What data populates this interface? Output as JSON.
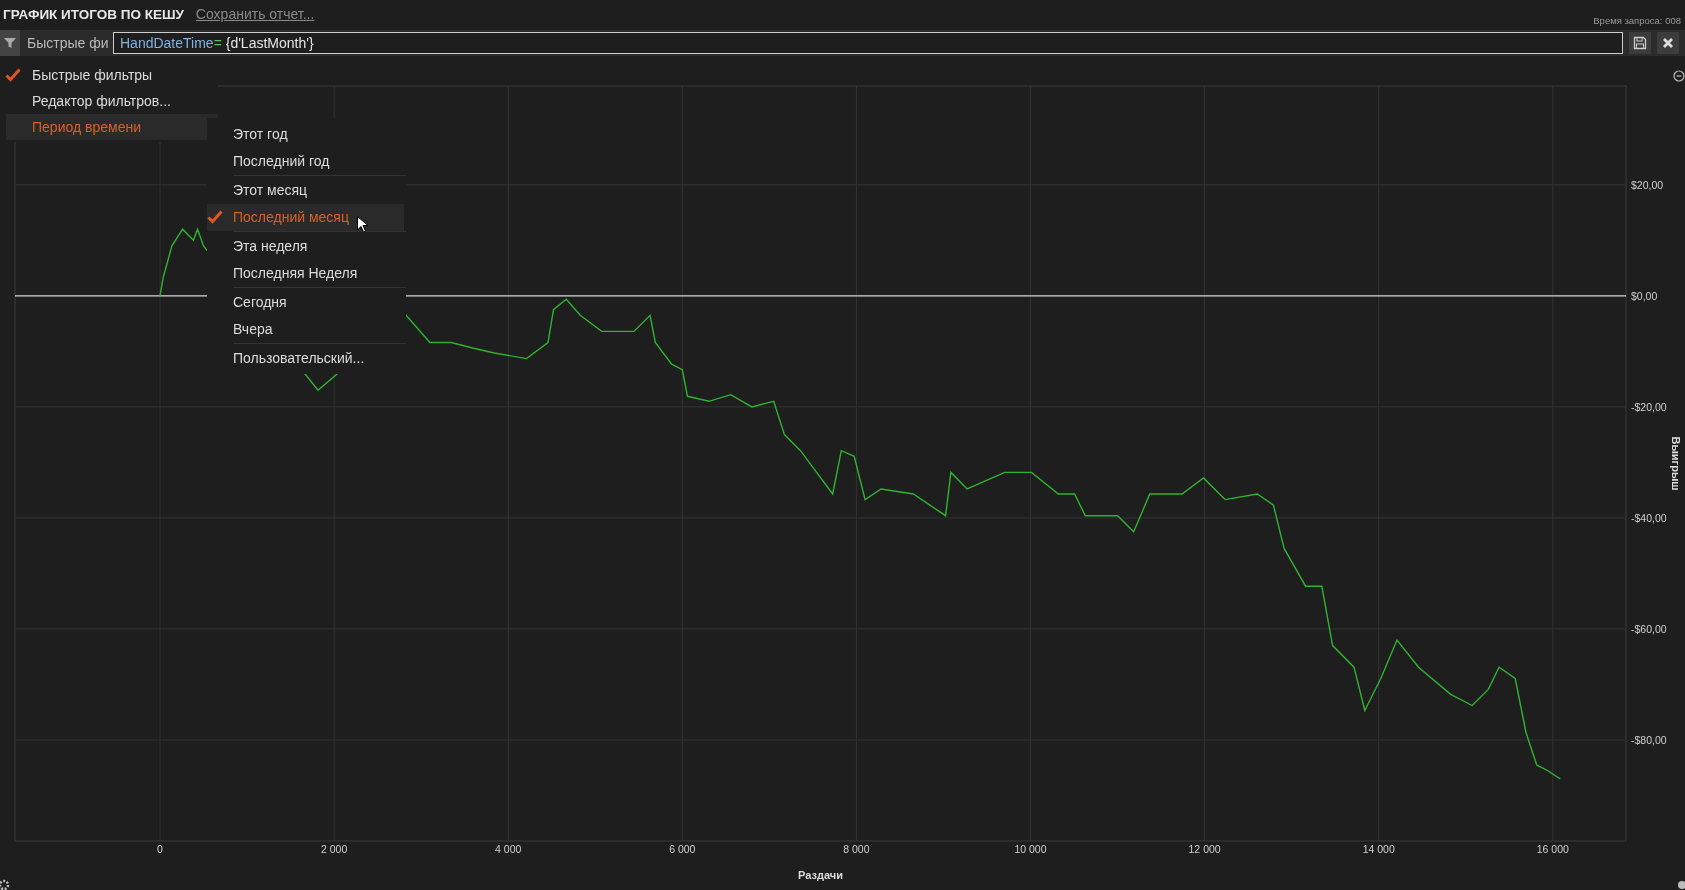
{
  "header": {
    "title": "ГРАФИК ИТОГОВ ПО КЕШУ",
    "save_link": "Сохранить отчет...",
    "query_time": "Время запроса: 008"
  },
  "filter_bar": {
    "label": "Быстрые фи",
    "expression": [
      {
        "kind": "field",
        "text": "HandDateTime"
      },
      {
        "kind": "operator",
        "text": "="
      },
      {
        "kind": "value",
        "text": " {d'LastMonth'}"
      }
    ]
  },
  "menu": {
    "items": [
      {
        "label": "Быстрые фильтры",
        "checked": true,
        "selected": false,
        "submenu": false
      },
      {
        "label": "Редактор фильтров...",
        "checked": false,
        "selected": false,
        "submenu": false
      },
      {
        "label": "Период времени",
        "checked": false,
        "selected": true,
        "submenu": true
      }
    ]
  },
  "submenu": {
    "items": [
      {
        "label": "Этот год",
        "checked": false,
        "selected": false,
        "separator_after": false
      },
      {
        "label": "Последний год",
        "checked": false,
        "selected": false,
        "separator_after": true
      },
      {
        "label": "Этот месяц",
        "checked": false,
        "selected": false,
        "separator_after": false
      },
      {
        "label": "Последний месяц",
        "checked": true,
        "selected": true,
        "separator_after": true
      },
      {
        "label": "Эта неделя",
        "checked": false,
        "selected": false,
        "separator_after": false
      },
      {
        "label": "Последняя Неделя",
        "checked": false,
        "selected": false,
        "separator_after": true
      },
      {
        "label": "Сегодня",
        "checked": false,
        "selected": false,
        "separator_after": false
      },
      {
        "label": "Вчера",
        "checked": false,
        "selected": false,
        "separator_after": true
      },
      {
        "label": "Пользовательский...",
        "checked": false,
        "selected": false,
        "separator_after": false
      }
    ]
  },
  "chart": {
    "chart_data": {
      "type": "line",
      "grid": true,
      "xlabel": "Раздачи",
      "ylabel": "Выигрыш",
      "xlim": [
        -1666,
        16841
      ],
      "ylim": [
        -98.2,
        37.8
      ],
      "xticks": [
        {
          "value": 0,
          "label": "0"
        },
        {
          "value": 2000,
          "label": "2 000"
        },
        {
          "value": 4000,
          "label": "4 000"
        },
        {
          "value": 6000,
          "label": "6 000"
        },
        {
          "value": 8000,
          "label": "8 000"
        },
        {
          "value": 10000,
          "label": "10 000"
        },
        {
          "value": 12000,
          "label": "12 000"
        },
        {
          "value": 14000,
          "label": "14 000"
        },
        {
          "value": 16000,
          "label": "16 000"
        }
      ],
      "yticks": [
        {
          "value": 20,
          "label": "$20,00"
        },
        {
          "value": 0,
          "label": "$0,00"
        },
        {
          "value": -20,
          "label": "-$20,00"
        },
        {
          "value": -40,
          "label": "-$40,00"
        },
        {
          "value": -60,
          "label": "-$60,00"
        },
        {
          "value": -80,
          "label": "-$80,00"
        }
      ],
      "x": [
        0,
        37,
        136,
        259,
        383,
        432,
        500,
        1815,
        2827,
        3100,
        3345,
        3590,
        3840,
        4210,
        4457,
        4520,
        4667,
        4827,
        5074,
        5444,
        5630,
        5690,
        5877,
        6000,
        6060,
        6307,
        6556,
        6800,
        7050,
        7173,
        7358,
        7543,
        7728,
        7827,
        7975,
        8100,
        8284,
        8654,
        9025,
        9086,
        9272,
        9704,
        10012,
        10321,
        10506,
        10630,
        11000,
        11185,
        11370,
        11740,
        11987,
        12235,
        12605,
        12790,
        12913,
        13160,
        13346,
        13470,
        13716,
        13840,
        14025,
        14210,
        14457,
        14827,
        15074,
        15259,
        15383,
        15568,
        15691,
        15815,
        15938,
        16086
      ],
      "series": [
        {
          "color": "#2fb32f",
          "values": [
            0,
            3.3,
            9,
            12,
            10,
            12,
            9,
            -17,
            -3.5,
            -8.4,
            -8.4,
            -9.4,
            -10.3,
            -11.3,
            -8.4,
            -2.5,
            -0.6,
            -3.5,
            -6.4,
            -6.4,
            -3.5,
            -8.4,
            -12.3,
            -13.3,
            -18.1,
            -19,
            -17.8,
            -20,
            -19,
            -25,
            -27.9,
            -31.8,
            -35.7,
            -27.9,
            -28.9,
            -36.7,
            -34.8,
            -35.7,
            -39.6,
            -31.8,
            -34.8,
            -31.8,
            -31.8,
            -35.7,
            -35.7,
            -39.6,
            -39.6,
            -42.5,
            -35.7,
            -35.7,
            -32.8,
            -36.7,
            -35.7,
            -37.7,
            -45.5,
            -52.3,
            -52.3,
            -63,
            -66.9,
            -74.7,
            -68.9,
            -62,
            -66.9,
            -71.8,
            -73.8,
            -70.9,
            -66.9,
            -68.9,
            -78.6,
            -84.5,
            -85.5,
            -87
          ]
        }
      ]
    }
  }
}
